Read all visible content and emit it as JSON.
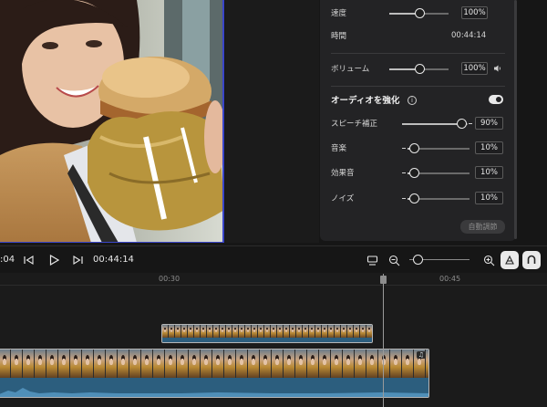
{
  "panel": {
    "speed": {
      "label": "速度",
      "value": "100%",
      "level": 0.5
    },
    "duration": {
      "label": "時間",
      "value": "00:44:14"
    },
    "volume": {
      "label": "ボリューム",
      "value": "100%",
      "level": 0.5
    },
    "enhance": {
      "title": "オーディオを強化",
      "enabled": true
    },
    "speech": {
      "label": "スピーチ補正",
      "value": "90%",
      "level": 0.9
    },
    "music": {
      "label": "音楽",
      "value": "10%",
      "level": 0.1
    },
    "sfx": {
      "label": "効果音",
      "value": "10%",
      "level": 0.1
    },
    "noise": {
      "label": "ノイズ",
      "value": "10%",
      "level": 0.1
    },
    "auto_button": "自動調節"
  },
  "toolbar": {
    "left_time": ":04",
    "current_time": "00:44:14"
  },
  "ruler": {
    "labels": [
      "00:30",
      "00:45"
    ]
  },
  "colors": {
    "accent": "#3a45c8",
    "audio": "#2c5e7e"
  },
  "icons": {
    "prev": "skip-back-icon",
    "play": "play-icon",
    "next": "skip-forward-icon",
    "volume": "speaker-icon",
    "info": "info-icon",
    "zoom_out": "zoom-out-icon",
    "zoom_in": "zoom-in-icon",
    "snap": "snap-icon",
    "magnet": "magnet-icon",
    "fit": "fit-icon"
  }
}
